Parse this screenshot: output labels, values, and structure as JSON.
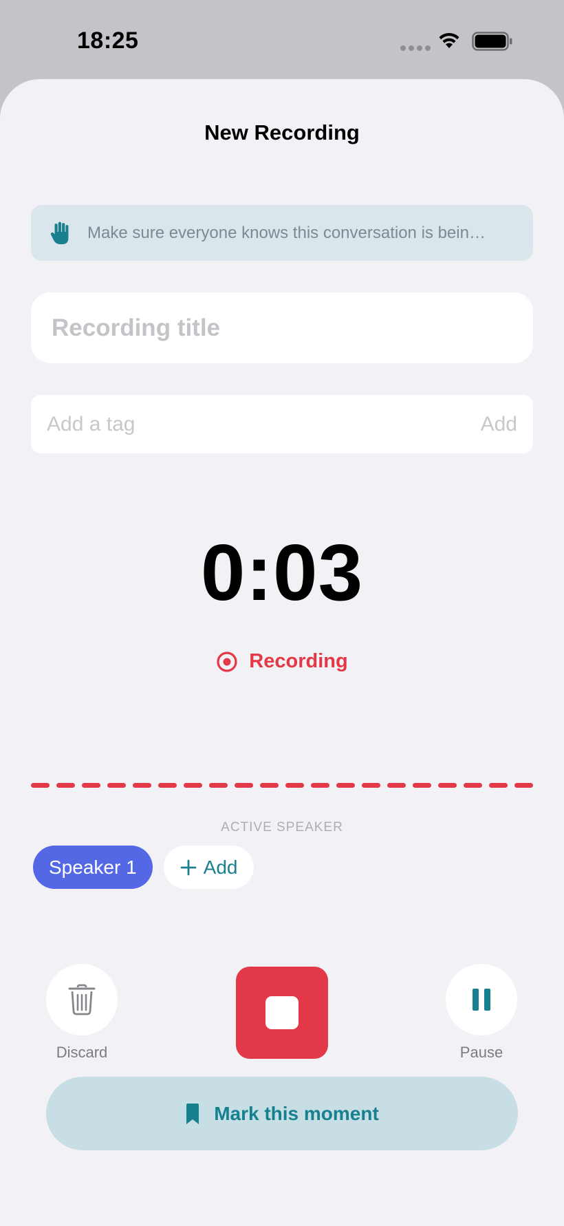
{
  "status_bar": {
    "time": "18:25"
  },
  "sheet": {
    "title": "New Recording"
  },
  "notice": {
    "text": "Make sure everyone knows this conversation is bein…",
    "icon": "hand-icon"
  },
  "title_field": {
    "value": "",
    "placeholder": "Recording title"
  },
  "tag_field": {
    "value": "",
    "placeholder": "Add a tag",
    "add_label": "Add"
  },
  "timer": {
    "elapsed": "0:03"
  },
  "status": {
    "label": "Recording",
    "color": "#e23847"
  },
  "speakers": {
    "heading": "ACTIVE SPEAKER",
    "active": "Speaker 1",
    "add_label": "Add",
    "active_color": "#5468e6"
  },
  "controls": {
    "discard_label": "Discard",
    "pause_label": "Pause",
    "mark_label": "Mark this moment",
    "stop_color": "#e23847",
    "accent_color": "#17808f"
  }
}
